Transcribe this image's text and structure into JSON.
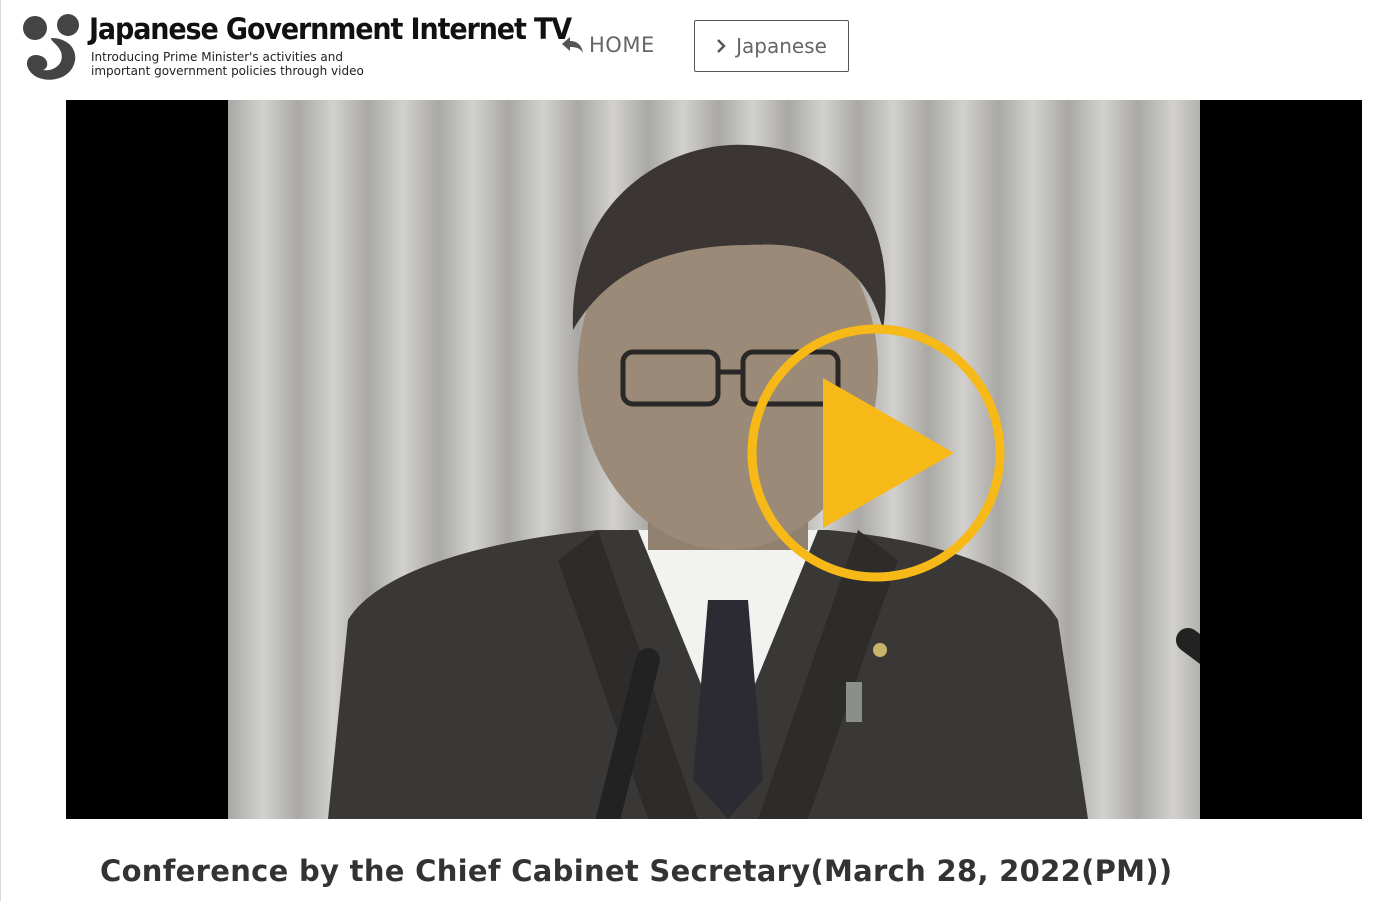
{
  "header": {
    "logo_title": "Japanese Government Internet TV",
    "logo_tagline_line1": "Introducing Prime Minister's activities and",
    "logo_tagline_line2": "important government policies through video",
    "home_label": "HOME",
    "language_label": "Japanese"
  },
  "player": {
    "play_icon": "play-icon",
    "accent_color": "#f7b918"
  },
  "main": {
    "title": "Conference by the Chief Cabinet Secretary(March 28, 2022(PM))"
  },
  "icons": {
    "logo": "logo-mark-icon",
    "home": "return-arrow-icon",
    "language": "chevron-right-icon"
  }
}
